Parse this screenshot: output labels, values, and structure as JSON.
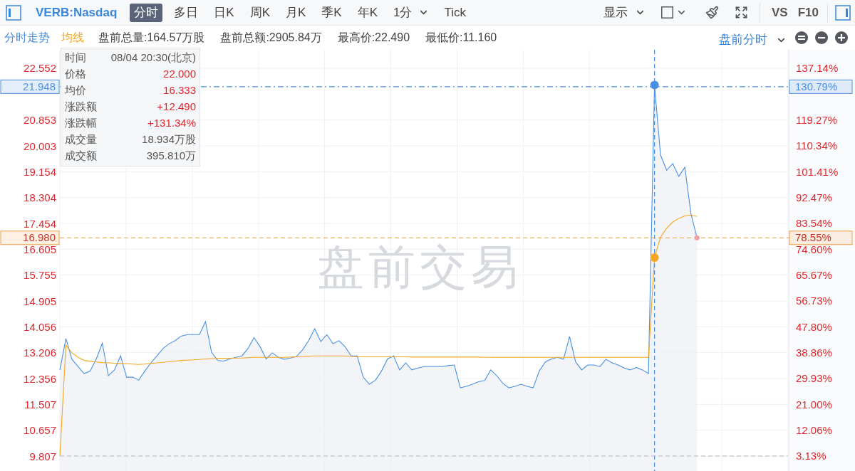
{
  "toolbar": {
    "symbol": "VERB:Nasdaq",
    "tabs": [
      {
        "label": "分时",
        "selected": true,
        "kind": "tab"
      },
      {
        "label": "多日",
        "selected": false,
        "kind": "tab"
      },
      {
        "label": "日K",
        "selected": false,
        "kind": "tab"
      },
      {
        "label": "周K",
        "selected": false,
        "kind": "tab"
      },
      {
        "label": "月K",
        "selected": false,
        "kind": "tab"
      },
      {
        "label": "季K",
        "selected": false,
        "kind": "tab"
      },
      {
        "label": "年K",
        "selected": false,
        "kind": "tab"
      },
      {
        "label": "1分",
        "selected": false,
        "kind": "dropdown"
      },
      {
        "label": "Tick",
        "selected": false,
        "kind": "tab"
      }
    ],
    "display": "显示",
    "vs": "VS",
    "f10": "F10"
  },
  "info_bar": {
    "stats": [
      "盘前总量:164.57万股",
      "盘前总额:2905.84万",
      "最高价:22.490",
      "最低价:11.160"
    ],
    "session": "盘前分时"
  },
  "overlay_text": "盘前交易",
  "tooltip": {
    "rows": [
      {
        "label": "时间",
        "value": "08/04 20:30(北京)",
        "kind": "plain"
      },
      {
        "label": "价格",
        "value": "22.000",
        "kind": "up"
      },
      {
        "label": "均价",
        "value": "16.333",
        "kind": "up"
      },
      {
        "label": "涨跌额",
        "value": "+12.490",
        "kind": "up"
      },
      {
        "label": "涨跌幅",
        "value": "+131.34%",
        "kind": "up"
      },
      {
        "label": "成交量",
        "value": "18.934万股",
        "kind": "plain"
      },
      {
        "label": "成交额",
        "value": "395.810万",
        "kind": "plain"
      }
    ]
  },
  "percent_markers": [
    "130.79%",
    "78.55%"
  ],
  "chart_data": {
    "type": "line",
    "grid": true,
    "ylim": [
      9.316,
      23.16
    ],
    "categories": [
      null,
      null,
      null,
      null,
      null,
      null,
      null,
      null,
      null,
      null,
      null,
      null,
      null,
      null,
      null,
      null,
      null,
      null,
      null,
      null,
      null,
      null,
      null,
      null,
      null,
      null,
      null,
      null,
      null,
      null,
      null,
      null,
      null,
      null,
      null,
      null,
      null,
      null,
      null,
      null,
      null,
      null,
      null,
      null,
      null,
      null,
      null,
      null,
      null,
      null,
      null,
      null,
      null,
      null,
      null,
      null,
      null,
      null,
      null,
      null,
      null,
      null,
      null,
      null,
      null,
      null,
      null,
      null,
      null,
      null,
      null,
      null,
      null,
      null,
      null,
      null,
      null,
      null,
      null,
      null,
      null,
      null,
      null,
      null,
      null,
      null,
      null,
      null,
      null,
      null,
      null,
      null,
      null,
      null,
      null,
      null,
      null,
      null,
      null,
      null,
      null,
      null,
      null,
      null,
      null,
      null,
      null,
      null,
      null,
      null,
      null,
      null,
      null,
      null,
      null,
      null,
      null,
      null,
      null,
      null
    ],
    "series": [
      {
        "name": "分时走势",
        "type": "area",
        "color": "#4a90e2",
        "values": [
          12.64,
          13.67,
          12.99,
          12.75,
          12.52,
          12.6,
          13.0,
          13.52,
          12.45,
          12.64,
          13.1,
          12.4,
          12.4,
          12.3,
          12.6,
          12.87,
          13.1,
          13.34,
          13.5,
          13.6,
          13.75,
          13.8,
          13.8,
          13.8,
          14.23,
          13.22,
          12.95,
          12.93,
          13.0,
          13.05,
          13.1,
          13.34,
          13.7,
          13.4,
          13.0,
          13.2,
          13.05,
          12.99,
          13.03,
          13.08,
          13.3,
          13.6,
          13.99,
          13.57,
          13.8,
          13.5,
          13.6,
          13.4,
          13.1,
          13.1,
          12.4,
          12.17,
          12.3,
          12.6,
          13.0,
          13.1,
          12.64,
          12.87,
          12.64,
          12.7,
          12.75,
          12.75,
          12.75,
          12.75,
          12.78,
          12.8,
          12.05,
          12.1,
          12.17,
          12.25,
          12.29,
          12.64,
          12.45,
          12.2,
          12.05,
          12.1,
          12.17,
          12.1,
          12.05,
          12.6,
          12.9,
          13.0,
          13.05,
          12.99,
          13.73,
          12.9,
          12.64,
          12.8,
          12.8,
          12.75,
          12.99,
          12.87,
          12.8,
          12.7,
          12.64,
          12.72,
          12.64,
          12.52,
          22.0,
          19.7,
          19.2,
          19.42,
          19.0,
          19.3,
          17.78,
          16.98,
          null,
          null,
          null,
          null,
          null,
          null,
          null,
          null,
          null,
          null,
          null,
          null,
          null,
          null
        ]
      },
      {
        "name": "均线",
        "type": "line",
        "color": "#f5a623",
        "values": [
          9.81,
          13.45,
          13.2,
          13.05,
          12.95,
          12.92,
          12.9,
          12.88,
          12.87,
          12.86,
          12.85,
          12.84,
          12.83,
          12.82,
          12.83,
          12.85,
          12.87,
          12.89,
          12.91,
          12.93,
          12.95,
          12.96,
          12.97,
          12.98,
          13.0,
          13.01,
          13.02,
          13.02,
          13.02,
          13.03,
          13.03,
          13.04,
          13.05,
          13.05,
          13.05,
          13.05,
          13.05,
          13.05,
          13.06,
          13.07,
          13.08,
          13.09,
          13.1,
          13.1,
          13.1,
          13.1,
          13.1,
          13.1,
          13.08,
          13.07,
          13.07,
          13.07,
          13.07,
          13.07,
          13.07,
          13.07,
          13.07,
          13.07,
          13.06,
          13.06,
          13.06,
          13.06,
          13.06,
          13.06,
          13.06,
          13.06,
          13.06,
          13.06,
          13.06,
          13.06,
          13.05,
          13.05,
          13.05,
          13.05,
          13.05,
          13.05,
          13.05,
          13.05,
          13.05,
          13.05,
          13.05,
          13.05,
          13.05,
          13.05,
          13.05,
          13.05,
          13.05,
          13.05,
          13.05,
          13.05,
          13.05,
          13.05,
          13.05,
          13.05,
          13.05,
          13.05,
          13.05,
          13.05,
          16.33,
          17.0,
          17.3,
          17.5,
          17.62,
          17.7,
          17.73,
          17.68,
          null,
          null,
          null,
          null,
          null,
          null,
          null,
          null,
          null,
          null,
          null,
          null,
          null,
          null
        ]
      }
    ],
    "yticks": [
      {
        "value": 22.552,
        "label": "22.552"
      },
      {
        "value": 20.853,
        "label": "20.853"
      },
      {
        "value": 20.003,
        "label": "20.003"
      },
      {
        "value": 19.154,
        "label": "19.154"
      },
      {
        "value": 18.304,
        "label": "18.304"
      },
      {
        "value": 17.454,
        "label": "17.454"
      },
      {
        "value": 16.605,
        "label": "16.605"
      },
      {
        "value": 15.755,
        "label": "15.755"
      },
      {
        "value": 14.905,
        "label": "14.905"
      },
      {
        "value": 14.056,
        "label": "14.056"
      },
      {
        "value": 13.206,
        "label": "13.206"
      },
      {
        "value": 12.356,
        "label": "12.356"
      },
      {
        "value": 11.507,
        "label": "11.507"
      },
      {
        "value": 10.657,
        "label": "10.657"
      },
      {
        "value": 9.807,
        "label": "9.807"
      }
    ],
    "y2lim": [
      -2.035,
      143.5
    ],
    "y2ticks": [
      {
        "value": 137.14,
        "label": "137.14%"
      },
      {
        "value": 119.27,
        "label": "119.27%"
      },
      {
        "value": 110.34,
        "label": "110.34%"
      },
      {
        "value": 101.41,
        "label": "101.41%"
      },
      {
        "value": 92.47,
        "label": "92.47%"
      },
      {
        "value": 83.54,
        "label": "83.54%"
      },
      {
        "value": 74.6,
        "label": "74.60%"
      },
      {
        "value": 65.67,
        "label": "65.67%"
      },
      {
        "value": 56.73,
        "label": "56.73%"
      },
      {
        "value": 47.8,
        "label": "47.80%"
      },
      {
        "value": 38.86,
        "label": "38.86%"
      },
      {
        "value": 29.93,
        "label": "29.93%"
      },
      {
        "value": 21.0,
        "label": "21.00%"
      },
      {
        "value": 12.06,
        "label": "12.06%"
      },
      {
        "value": 3.13,
        "label": "3.13%"
      }
    ],
    "ref_lines": [
      {
        "axis": "y",
        "value": 9.807,
        "color": "#b4b8be"
      },
      {
        "axis": "y",
        "value": 21.948,
        "label": "21.948",
        "color": "#4a90e2"
      },
      {
        "axis": "y",
        "value": 16.98,
        "label": "16.980",
        "color": "#f0a040"
      }
    ]
  }
}
